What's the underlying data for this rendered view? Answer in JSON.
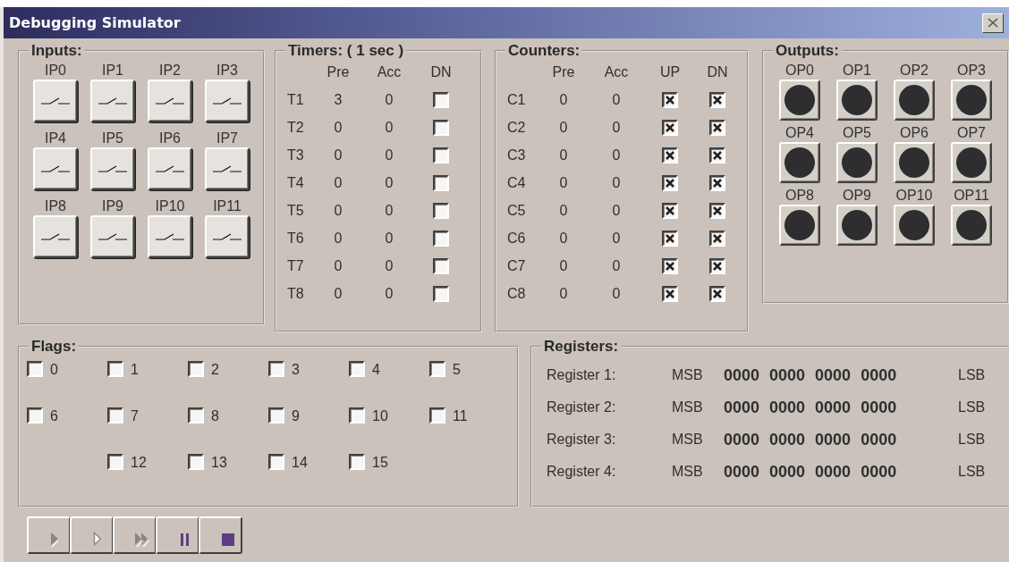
{
  "window": {
    "title": "Debugging Simulator"
  },
  "inputs": {
    "title": "Inputs:",
    "items": [
      {
        "label": "IP0"
      },
      {
        "label": "IP1"
      },
      {
        "label": "IP2"
      },
      {
        "label": "IP3"
      },
      {
        "label": "IP4"
      },
      {
        "label": "IP5"
      },
      {
        "label": "IP6"
      },
      {
        "label": "IP7"
      },
      {
        "label": "IP8"
      },
      {
        "label": "IP9"
      },
      {
        "label": "IP10"
      },
      {
        "label": "IP11"
      }
    ]
  },
  "timers": {
    "title": "Timers: ( 1 sec )",
    "columns": [
      "Pre",
      "Acc",
      "DN"
    ],
    "rows": [
      {
        "name": "T1",
        "pre": "3",
        "acc": "0",
        "done": false
      },
      {
        "name": "T2",
        "pre": "0",
        "acc": "0",
        "done": false
      },
      {
        "name": "T3",
        "pre": "0",
        "acc": "0",
        "done": false
      },
      {
        "name": "T4",
        "pre": "0",
        "acc": "0",
        "done": false
      },
      {
        "name": "T5",
        "pre": "0",
        "acc": "0",
        "done": false
      },
      {
        "name": "T6",
        "pre": "0",
        "acc": "0",
        "done": false
      },
      {
        "name": "T7",
        "pre": "0",
        "acc": "0",
        "done": false
      },
      {
        "name": "T8",
        "pre": "0",
        "acc": "0",
        "done": false
      }
    ]
  },
  "counters": {
    "title": "Counters:",
    "columns": [
      "Pre",
      "Acc",
      "UP",
      "DN"
    ],
    "rows": [
      {
        "name": "C1",
        "pre": "0",
        "acc": "0",
        "up": true,
        "down": true
      },
      {
        "name": "C2",
        "pre": "0",
        "acc": "0",
        "up": true,
        "down": true
      },
      {
        "name": "C3",
        "pre": "0",
        "acc": "0",
        "up": true,
        "down": true
      },
      {
        "name": "C4",
        "pre": "0",
        "acc": "0",
        "up": true,
        "down": true
      },
      {
        "name": "C5",
        "pre": "0",
        "acc": "0",
        "up": true,
        "down": true
      },
      {
        "name": "C6",
        "pre": "0",
        "acc": "0",
        "up": true,
        "down": true
      },
      {
        "name": "C7",
        "pre": "0",
        "acc": "0",
        "up": true,
        "down": true
      },
      {
        "name": "C8",
        "pre": "0",
        "acc": "0",
        "up": true,
        "down": true
      }
    ]
  },
  "outputs": {
    "title": "Outputs:",
    "items": [
      {
        "label": "OP0",
        "on": false
      },
      {
        "label": "OP1",
        "on": false
      },
      {
        "label": "OP2",
        "on": false
      },
      {
        "label": "OP3",
        "on": false
      },
      {
        "label": "OP4",
        "on": false
      },
      {
        "label": "OP5",
        "on": false
      },
      {
        "label": "OP6",
        "on": false
      },
      {
        "label": "OP7",
        "on": false
      },
      {
        "label": "OP8",
        "on": false
      },
      {
        "label": "OP9",
        "on": false
      },
      {
        "label": "OP10",
        "on": false
      },
      {
        "label": "OP11",
        "on": false
      }
    ]
  },
  "flags": {
    "title": "Flags:",
    "items": [
      {
        "label": "0",
        "checked": false
      },
      {
        "label": "1",
        "checked": false
      },
      {
        "label": "2",
        "checked": false
      },
      {
        "label": "3",
        "checked": false
      },
      {
        "label": "4",
        "checked": false
      },
      {
        "label": "5",
        "checked": false
      },
      {
        "label": "6",
        "checked": false
      },
      {
        "label": "7",
        "checked": false
      },
      {
        "label": "8",
        "checked": false
      },
      {
        "label": "9",
        "checked": false
      },
      {
        "label": "10",
        "checked": false
      },
      {
        "label": "11",
        "checked": false
      },
      {
        "label": "12",
        "checked": false
      },
      {
        "label": "13",
        "checked": false
      },
      {
        "label": "14",
        "checked": false
      },
      {
        "label": "15",
        "checked": false
      }
    ]
  },
  "registers": {
    "title": "Registers:",
    "rows": [
      {
        "label": "Register 1:",
        "msb": "MSB",
        "value": "0000 0000 0000 0000",
        "lsb": "LSB"
      },
      {
        "label": "Register 2:",
        "msb": "MSB",
        "value": "0000 0000 0000 0000",
        "lsb": "LSB"
      },
      {
        "label": "Register 3:",
        "msb": "MSB",
        "value": "0000 0000 0000 0000",
        "lsb": "LSB"
      },
      {
        "label": "Register 4:",
        "msb": "MSB",
        "value": "0000 0000 0000 0000",
        "lsb": "LSB"
      }
    ]
  },
  "controls": [
    {
      "kind": "run"
    },
    {
      "kind": "step"
    },
    {
      "kind": "fast"
    },
    {
      "kind": "pause"
    },
    {
      "kind": "stop"
    }
  ]
}
